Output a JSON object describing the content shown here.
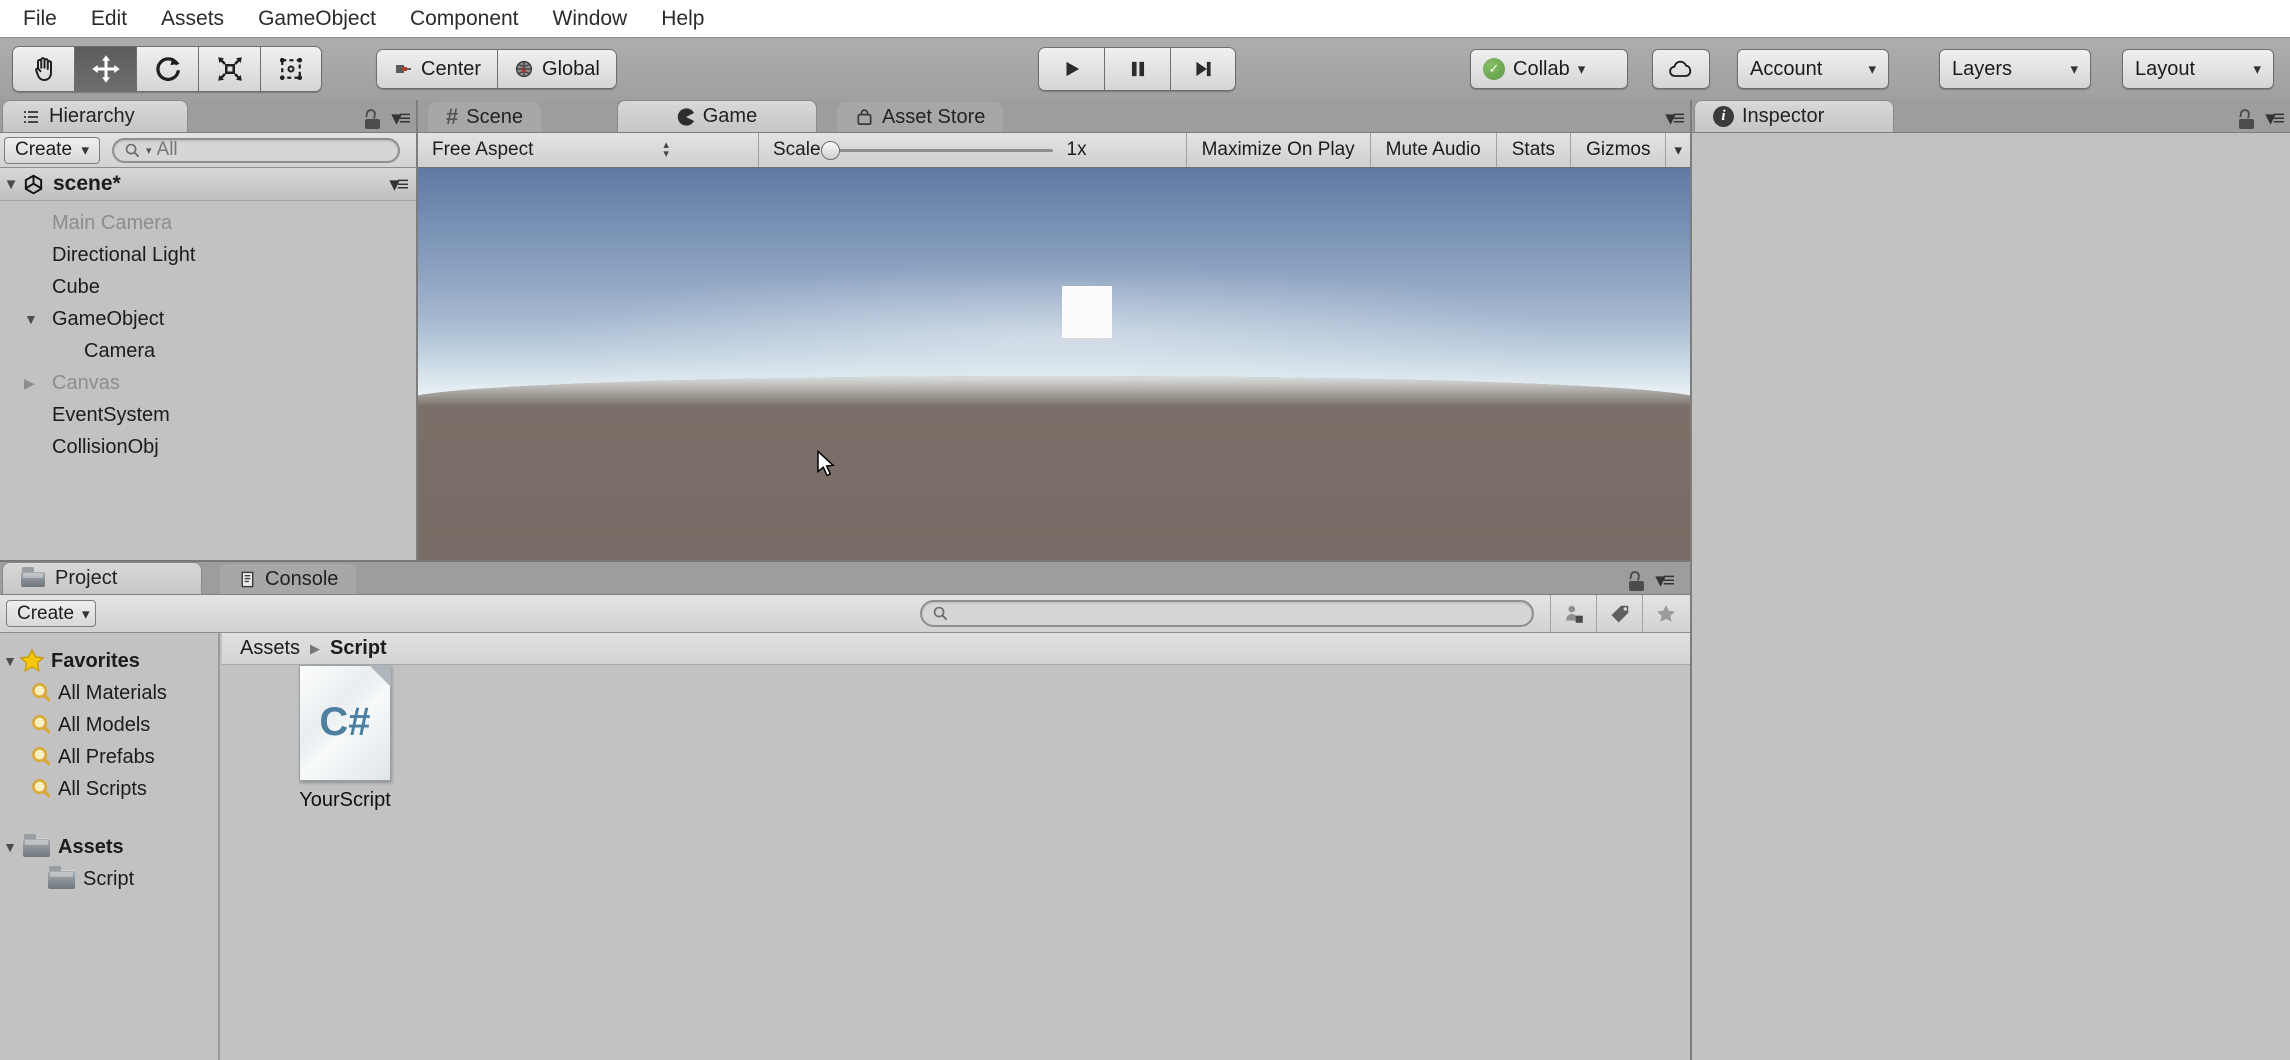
{
  "menu": {
    "items": [
      "File",
      "Edit",
      "Assets",
      "GameObject",
      "Component",
      "Window",
      "Help"
    ]
  },
  "toolbar": {
    "center_label": "Center",
    "global_label": "Global",
    "collab_label": "Collab",
    "account_label": "Account",
    "layers_label": "Layers",
    "layout_label": "Layout"
  },
  "hierarchy": {
    "tab_label": "Hierarchy",
    "create_label": "Create",
    "search_value": "All",
    "scene_label": "scene*",
    "items": [
      {
        "label": "Main Camera",
        "arrow": ""
      },
      {
        "label": "Directional Light",
        "arrow": ""
      },
      {
        "label": "Cube",
        "arrow": ""
      },
      {
        "label": "GameObject",
        "arrow": "▼"
      },
      {
        "label": "Camera",
        "arrow": ""
      },
      {
        "label": "Canvas",
        "arrow": "▶"
      },
      {
        "label": "EventSystem",
        "arrow": ""
      },
      {
        "label": "CollisionObj",
        "arrow": ""
      }
    ]
  },
  "center": {
    "scene_tab": "Scene",
    "game_tab": "Game",
    "asset_store_tab": "Asset Store",
    "aspect_label": "Free Aspect",
    "scale_label": "Scale",
    "scale_value": "1x",
    "maximize_label": "Maximize On Play",
    "mute_label": "Mute Audio",
    "stats_label": "Stats",
    "gizmos_label": "Gizmos"
  },
  "inspector": {
    "tab_label": "Inspector"
  },
  "project": {
    "tab_label": "Project",
    "console_label": "Console",
    "create_label": "Create",
    "search_value": "",
    "favorites_label": "Favorites",
    "favorites": [
      "All Materials",
      "All Models",
      "All Prefabs",
      "All Scripts"
    ],
    "assets_label": "Assets",
    "subfolder_label": "Script",
    "breadcrumb_root": "Assets",
    "breadcrumb_current": "Script",
    "file_label": "YourScript",
    "file_type": "C#"
  },
  "colors": {
    "collab_green": "#5c9a44",
    "favorites_gold": "#f2c200",
    "csharp_blue": "#4d7fa0",
    "sky_top": "#5f7aa2",
    "sky_horizon": "#eff4f6",
    "ground_brown": "#786d66"
  }
}
